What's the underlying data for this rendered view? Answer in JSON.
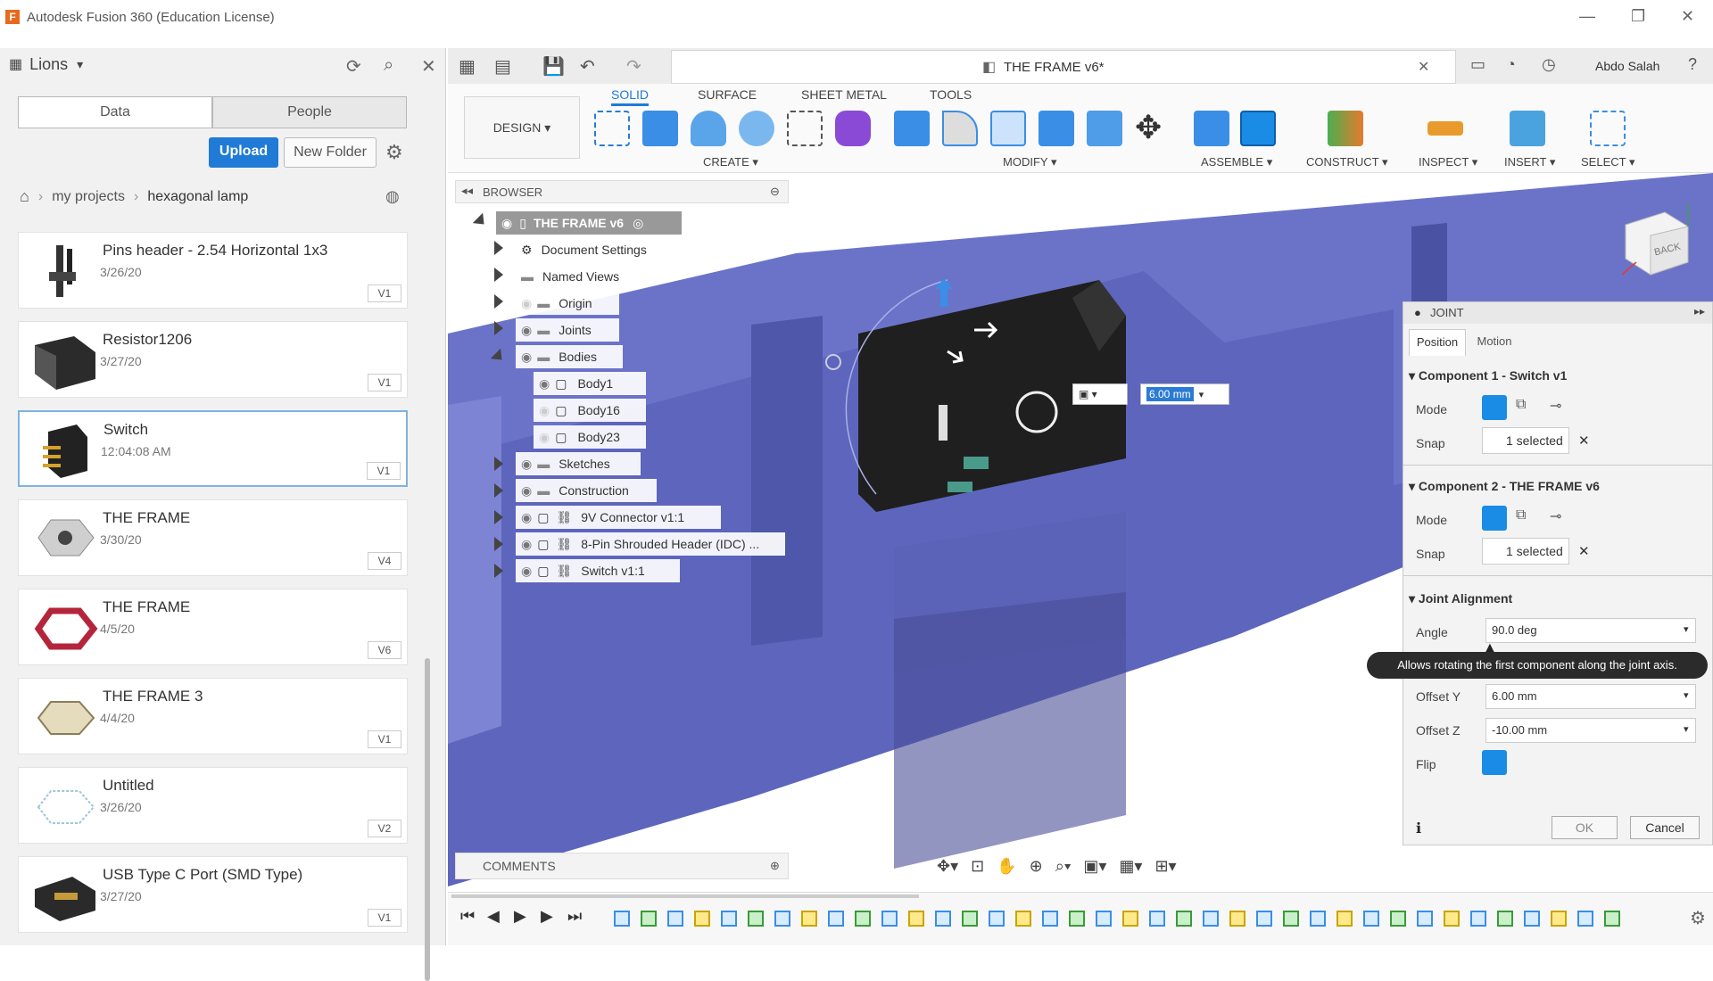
{
  "window": {
    "title": "Autodesk Fusion 360 (Education License)"
  },
  "left_panel": {
    "project": "Lions",
    "tabs": {
      "data": "Data",
      "people": "People"
    },
    "buttons": {
      "upload": "Upload",
      "new_folder": "New Folder"
    },
    "breadcrumb": {
      "root": "my projects",
      "current": "hexagonal lamp"
    },
    "files": [
      {
        "title": "Pins header - 2.54 Horizontal 1x3",
        "date": "3/26/20",
        "version": "V1"
      },
      {
        "title": "Resistor1206",
        "date": "3/27/20",
        "version": "V1"
      },
      {
        "title": "Switch",
        "date": "12:04:08 AM",
        "version": "V1"
      },
      {
        "title": "THE FRAME",
        "date": "3/30/20",
        "version": "V4"
      },
      {
        "title": "THE FRAME",
        "date": "4/5/20",
        "version": "V6"
      },
      {
        "title": "THE FRAME 3",
        "date": "4/4/20",
        "version": "V1"
      },
      {
        "title": "Untitled",
        "date": "3/26/20",
        "version": "V2"
      },
      {
        "title": "USB Type C Port (SMD Type)",
        "date": "3/27/20",
        "version": "V1"
      }
    ]
  },
  "document": {
    "tab_title": "THE FRAME v6*",
    "user": "Abdo Salah"
  },
  "ribbon": {
    "workspace": "DESIGN",
    "tabs": [
      "SOLID",
      "SURFACE",
      "SHEET METAL",
      "TOOLS"
    ],
    "groups": [
      "CREATE",
      "MODIFY",
      "ASSEMBLE",
      "CONSTRUCT",
      "INSPECT",
      "INSERT",
      "SELECT"
    ]
  },
  "browser": {
    "title": "BROWSER",
    "root": "THE FRAME v6",
    "items": [
      "Document Settings",
      "Named Views",
      "Origin",
      "Joints",
      "Bodies",
      "Body1",
      "Body16",
      "Body23",
      "Sketches",
      "Construction",
      "9V Connector v1:1",
      "8-Pin Shrouded Header (IDC) ...",
      "Switch v1:1"
    ]
  },
  "viewport": {
    "dimension_value": "6.00 mm",
    "viewcube_label": "BACK"
  },
  "joint": {
    "title": "JOINT",
    "tabs": {
      "position": "Position",
      "motion": "Motion"
    },
    "component1": "Component 1 - Switch v1",
    "component2": "Component 2 - THE FRAME v6",
    "mode_label": "Mode",
    "snap_label": "Snap",
    "snap_value": "1 selected",
    "alignment": "Joint Alignment",
    "angle_label": "Angle",
    "angle_value": "90.0 deg",
    "tooltip": "Allows rotating the first component along the joint axis.",
    "offset_y_label": "Offset Y",
    "offset_y_value": "6.00 mm",
    "offset_z_label": "Offset Z",
    "offset_z_value": "-10.00 mm",
    "flip_label": "Flip",
    "ok": "OK",
    "cancel": "Cancel"
  },
  "comments": {
    "title": "COMMENTS"
  },
  "colors": {
    "accent": "#1f7bd5",
    "model": "#6b73c9",
    "toggle": "#1a8ce5"
  }
}
